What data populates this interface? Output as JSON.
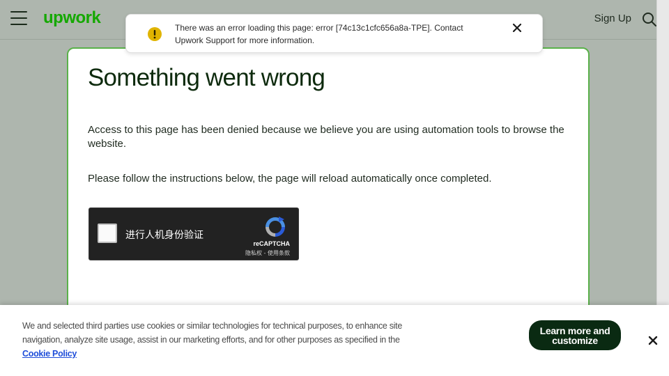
{
  "header": {
    "logo_text": "upwork",
    "signup_label": "Sign Up",
    "icons": {
      "menu": "hamburger-menu-icon",
      "search": "search-icon"
    }
  },
  "toast": {
    "message": "There was an error loading this page: error [74c13c1cfc656a8a-TPE]. Contact Upwork Support for more information.",
    "icon": "warning-icon",
    "close_icon": "close-icon"
  },
  "main": {
    "title": "Something went wrong",
    "paragraph_1": "Access to this page has been denied because we believe you are using automation tools to browse the website.",
    "paragraph_2": "Please follow the instructions below, the page will reload automatically once completed."
  },
  "recaptcha": {
    "label": "进行人机身份验证",
    "brand": "reCAPTCHA",
    "terms": "隐私权 - 使用条款"
  },
  "cookie_banner": {
    "text": "We and selected third parties use cookies or similar technologies for technical purposes, to enhance site navigation, analyze site usage, assist in our marketing efforts, and for other purposes as specified in the",
    "link_label": "Cookie Policy",
    "button_label": "Learn more and customize"
  },
  "colors": {
    "brand_green": "#14a800",
    "cookie_button": "#0a2a12",
    "warning_yellow": "#e0b400",
    "link_blue": "#1e4dd9"
  }
}
